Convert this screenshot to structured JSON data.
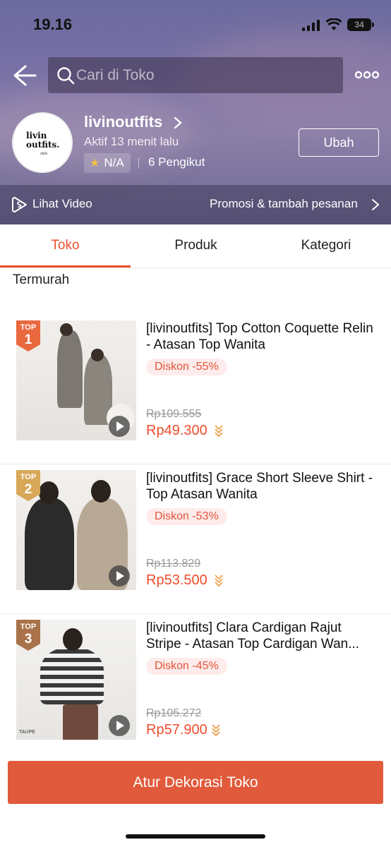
{
  "status_bar": {
    "time": "19.16",
    "battery": "34"
  },
  "search": {
    "placeholder": "Cari di Toko"
  },
  "shop": {
    "logo_text": "livin\noutfits.",
    "logo_sub": "style",
    "name": "livinoutfits",
    "active_status": "Aktif 13 menit lalu",
    "rating": "N/A",
    "followers": "6 Pengikut",
    "edit_label": "Ubah"
  },
  "video_bar": {
    "video_label": "Lihat Video",
    "promo_label": "Promosi & tambah pesanan"
  },
  "tabs": [
    {
      "label": "Toko",
      "active": true
    },
    {
      "label": "Produk",
      "active": false
    },
    {
      "label": "Kategori",
      "active": false
    }
  ],
  "section_title": "Termurah",
  "products": [
    {
      "rank_label": "TOP",
      "rank": "1",
      "title": "[livinoutfits] Top Cotton Coquette Relin - Atasan Top Wanita",
      "discount": "Diskon -55%",
      "old_price": "Rp109.555",
      "price": "Rp49.300",
      "badge_color": "#e9683e"
    },
    {
      "rank_label": "TOP",
      "rank": "2",
      "title": "[livinoutfits] Grace Short Sleeve Shirt - Top Atasan Wanita",
      "discount": "Diskon -53%",
      "old_price": "Rp113.829",
      "price": "Rp53.500",
      "badge_color": "#d7a857"
    },
    {
      "rank_label": "TOP",
      "rank": "3",
      "title": "[livinoutfits] Clara Cardigan Rajut Stripe - Atasan Top Cardigan Wan...",
      "discount": "Diskon -45%",
      "old_price": "Rp105.272",
      "price": "Rp57.900",
      "badge_color": "#a9724a",
      "image_caption": "TAUPE"
    }
  ],
  "cta_label": "Atur Dekorasi Toko",
  "colors": {
    "accent": "#ee4d2d",
    "cta": "#e05a3b"
  }
}
